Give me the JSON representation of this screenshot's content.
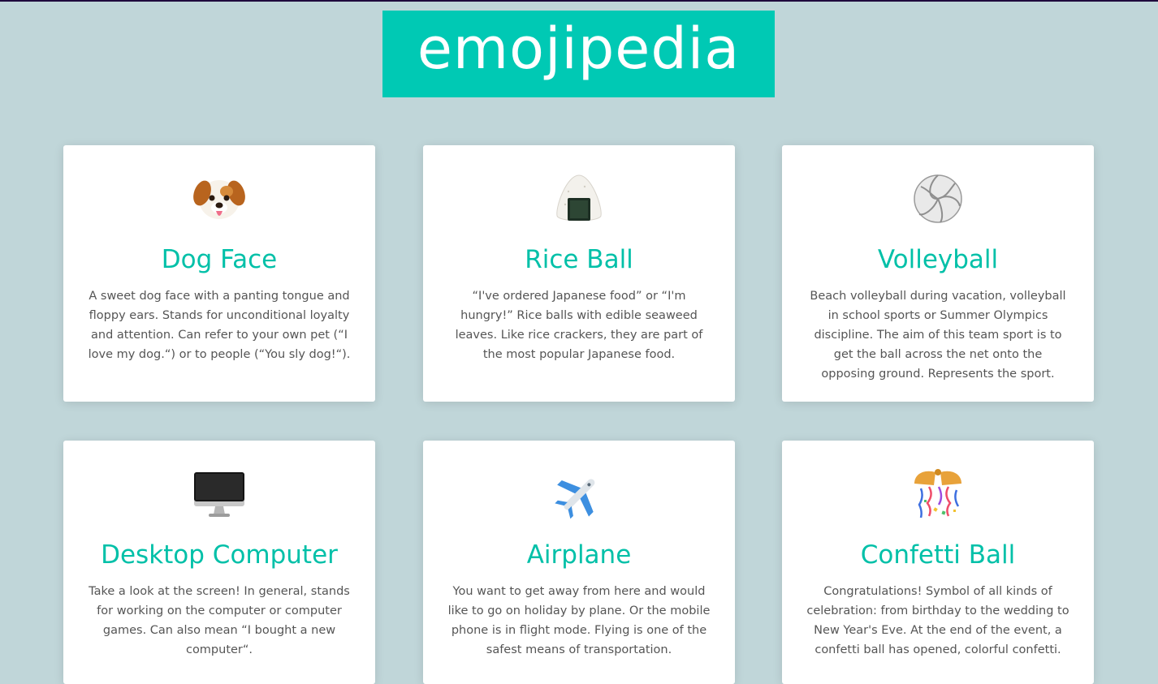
{
  "header": {
    "title": "emojipedia"
  },
  "cards": [
    {
      "emoji_icon": "dog-face-icon",
      "title": "Dog Face",
      "description": "A sweet dog face with a panting tongue and floppy ears. Stands for unconditional loyalty and attention. Can refer to your own pet (“I love my dog.“) or to people (“You sly dog!“)."
    },
    {
      "emoji_icon": "rice-ball-icon",
      "title": "Rice Ball",
      "description": "“I've ordered Japanese food” or “I'm hungry!” Rice balls with edible seaweed leaves. Like rice crackers, they are part of the most popular Japanese food."
    },
    {
      "emoji_icon": "volleyball-icon",
      "title": "Volleyball",
      "description": "Beach volleyball during vacation, volleyball in school sports or Summer Olympics discipline. The aim of this team sport is to get the ball across the net onto the opposing ground. Represents the sport."
    },
    {
      "emoji_icon": "desktop-computer-icon",
      "title": "Desktop Computer",
      "description": "Take a look at the screen! In general, stands for working on the computer or computer games. Can also mean “I bought a new computer“."
    },
    {
      "emoji_icon": "airplane-icon",
      "title": "Airplane",
      "description": "You want to get away from here and would like to go on holiday by plane. Or the mobile phone is in flight mode. Flying is one of the safest means of transportation."
    },
    {
      "emoji_icon": "confetti-ball-icon",
      "title": "Confetti Ball",
      "description": "Congratulations! Symbol of all kinds of celebration: from birthday to the wedding to New Year's Eve. At the end of the event, a confetti ball has opened, colorful confetti."
    }
  ],
  "colors": {
    "background": "#c0d6d9",
    "accent": "#00c9b4",
    "title_text": "#00c0a8",
    "body_text": "#555555"
  }
}
